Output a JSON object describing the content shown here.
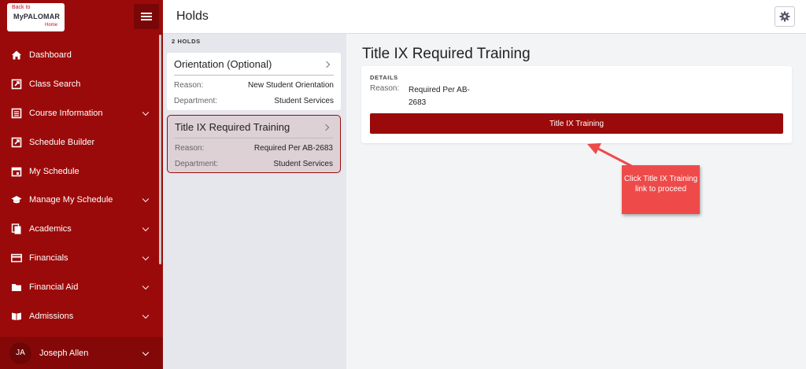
{
  "logo": {
    "back": "Back to",
    "brand": "MyPALOMAR",
    "home": "Home"
  },
  "nav": {
    "items": [
      {
        "label": "Dashboard",
        "icon": "home-icon",
        "chevron": false
      },
      {
        "label": "Class Search",
        "icon": "external-link-icon",
        "chevron": false
      },
      {
        "label": "Course Information",
        "icon": "list-icon",
        "chevron": true
      },
      {
        "label": "Schedule Builder",
        "icon": "external-link-icon",
        "chevron": false
      },
      {
        "label": "My Schedule",
        "icon": "calendar-icon",
        "chevron": false
      },
      {
        "label": "Manage My Schedule",
        "icon": "graduation-cap-icon",
        "chevron": true
      },
      {
        "label": "Academics",
        "icon": "copy-icon",
        "chevron": true
      },
      {
        "label": "Financials",
        "icon": "credit-card-icon",
        "chevron": true
      },
      {
        "label": "Financial Aid",
        "icon": "folder-icon",
        "chevron": true
      },
      {
        "label": "Admissions",
        "icon": "book-icon",
        "chevron": true
      }
    ]
  },
  "user": {
    "initials": "JA",
    "name": "Joseph Allen"
  },
  "header": {
    "title": "Holds"
  },
  "holds": {
    "count_label": "2 HOLDS",
    "items": [
      {
        "title": "Orientation (Optional)",
        "reason_label": "Reason:",
        "reason": "New Student Orientation",
        "department_label": "Department:",
        "department": "Student Services"
      },
      {
        "title": "Title IX Required Training",
        "reason_label": "Reason:",
        "reason": "Required Per AB-2683",
        "department_label": "Department:",
        "department": "Student Services"
      }
    ]
  },
  "detail": {
    "title": "Title IX Required Training",
    "details_label": "DETAILS",
    "reason_label": "Reason:",
    "reason": "Required Per AB-2683",
    "button_label": "Title IX Training"
  },
  "annotation": {
    "text": "Click Title IX Training link to proceed",
    "color": "#ee4a4a"
  },
  "colors": {
    "brand": "#9b0a0a",
    "panel": "#e5e7ed"
  }
}
